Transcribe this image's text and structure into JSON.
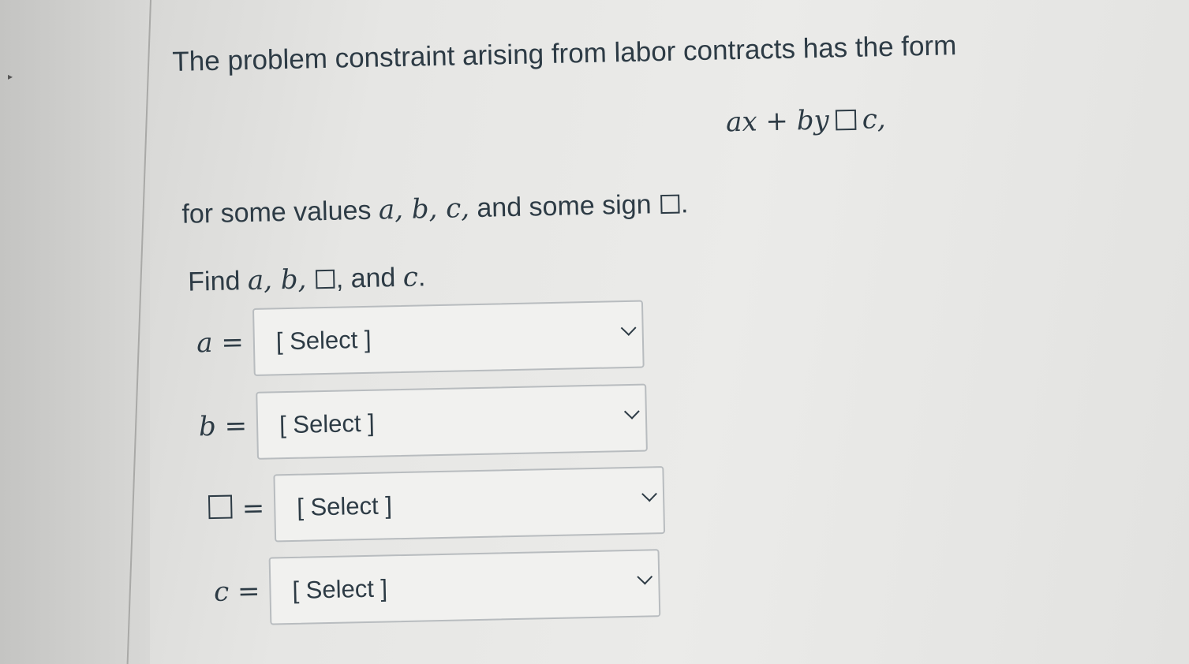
{
  "question": {
    "intro": "The problem constraint arising from labor contracts has the form",
    "formula": {
      "a": "ax",
      "plus": "+",
      "b": "by",
      "c": "c,"
    },
    "sign_line": {
      "prefix": "for some values ",
      "vars": "a, b, c,",
      "suffix": " and some sign ",
      "end": "."
    },
    "find_line": {
      "prefix": "Find ",
      "vars": "a, b,",
      "middle": ", and ",
      "last_var": "c",
      "end": "."
    }
  },
  "answers": [
    {
      "label": "a",
      "equals": "=",
      "value": "[ Select ]"
    },
    {
      "label": "b",
      "equals": "=",
      "value": "[ Select ]"
    },
    {
      "label": "",
      "equals": "=",
      "value": "[ Select ]"
    },
    {
      "label": "c",
      "equals": "=",
      "value": "[ Select ]"
    }
  ],
  "icons": {
    "dropdown": "chevron-down-icon",
    "sign_placeholder": "square-placeholder-icon"
  },
  "colors": {
    "text": "#2d3b45",
    "select_bg": "#f1f1ef",
    "select_border": "#b8bcbf"
  }
}
